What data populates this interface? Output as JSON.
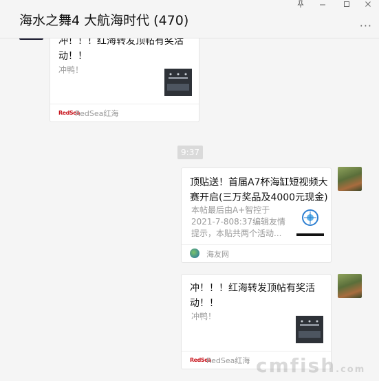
{
  "window": {
    "title": "海水之舞4 大航海时代 (470)",
    "pin_icon": "pin-icon",
    "minimize_icon": "minimize-icon",
    "maximize_icon": "maximize-icon",
    "close_icon": "close-icon",
    "more_icon": "more-icon"
  },
  "messages": [
    {
      "side": "left",
      "title": "冲！！！红海转发顶帖有奖活动！！",
      "desc": "冲鸭！",
      "source_logo": "RedSea",
      "source": "RedSea红海"
    },
    {
      "side": "right",
      "title": "顶贴送！首届A7杯海缸短视频大赛开启(三万奖品及4000元现金)",
      "desc": "本帖最后由A+智控于2021-7-808:37编辑友情提示，本贴共两个活动...",
      "source": "海友网"
    },
    {
      "side": "right",
      "title": "冲！！！红海转发顶帖有奖活动！！",
      "desc": "冲鸭！",
      "source_logo": "RedSea",
      "source": "RedSea红海"
    }
  ],
  "timestamp": "9:37",
  "watermark": "cmfish",
  "watermark_suffix": ".com",
  "colors": {
    "background": "#f5f5f5",
    "card": "#ffffff",
    "time_badge": "#dadada"
  }
}
